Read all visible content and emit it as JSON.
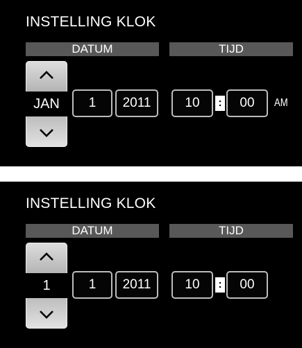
{
  "screens": [
    {
      "title": "INSTELLING KLOK",
      "date_header": "DATUM",
      "time_header": "TIJD",
      "spinner_value": "JAN",
      "day": "1",
      "year": "2011",
      "hour": "10",
      "separator": ":",
      "minute": "00",
      "ampm": "AM"
    },
    {
      "title": "INSTELLING KLOK",
      "date_header": "DATUM",
      "time_header": "TIJD",
      "spinner_value": "1",
      "day": "1",
      "year": "2011",
      "hour": "10",
      "separator": ":",
      "minute": "00"
    }
  ],
  "icons": {
    "up": "chevron-up-icon",
    "down": "chevron-down-icon"
  },
  "colors": {
    "background": "#000000",
    "header_bar": "#585858",
    "text": "#ffffff",
    "field_border": "#bdbdbd",
    "spinner": "#c0c0c0"
  }
}
